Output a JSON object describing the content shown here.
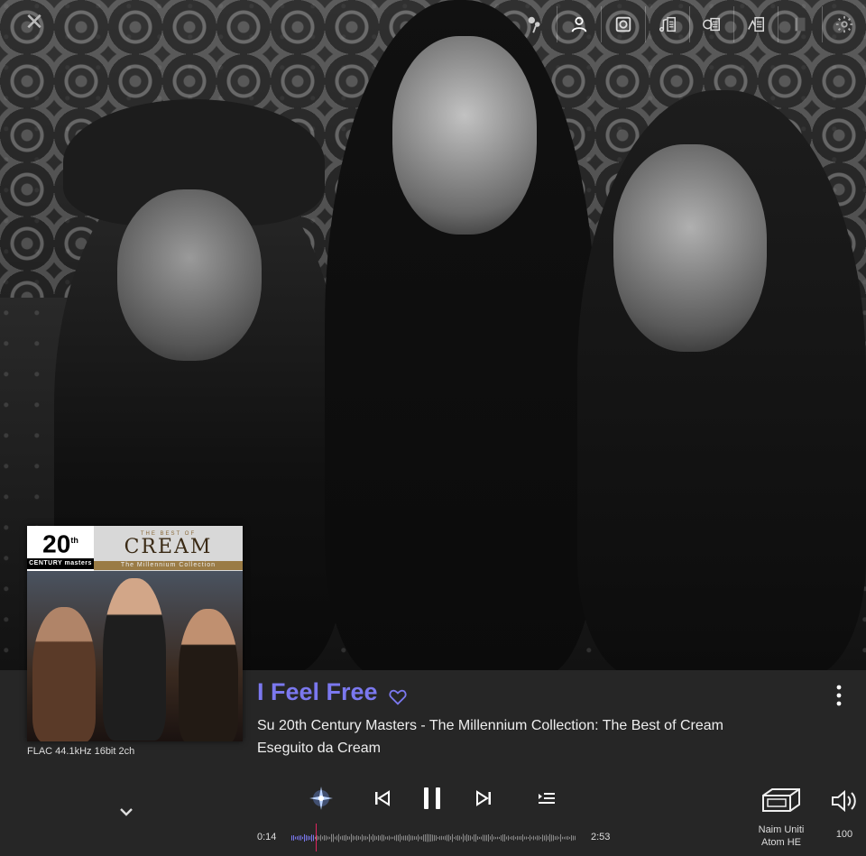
{
  "toolbar": {
    "icons": [
      "close-icon",
      "pin-icon",
      "artist-icon",
      "album-icon",
      "lyrics-icon",
      "credits-icon",
      "review-icon",
      "book-icon",
      "settings-icon"
    ]
  },
  "cover": {
    "badge_number": "20",
    "badge_sup": "th",
    "badge_sub": "CENTURY masters",
    "best_of": "THE BEST OF",
    "band": "CREAM",
    "subtitle": "The Millennium Collection"
  },
  "now_playing": {
    "title": "I Feel Free",
    "album_line": "Su 20th Century Masters - The Millennium Collection: The Best of Cream",
    "artist_line": "Eseguito da Cream",
    "format": "FLAC 44.1kHz  16bit  2ch",
    "elapsed": "0:14",
    "duration": "2:53",
    "progress": 0.081,
    "accent_color": "#7b78ef",
    "playhead_color": "#e0245e"
  },
  "output": {
    "device_line1": "Naim Uniti",
    "device_line2": "Atom HE",
    "volume": "100"
  }
}
